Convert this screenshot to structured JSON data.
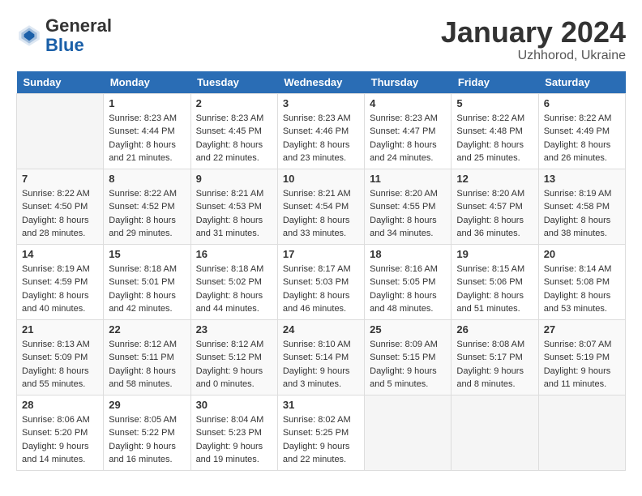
{
  "header": {
    "logo": {
      "general": "General",
      "blue": "Blue"
    },
    "title": "January 2024",
    "location": "Uzhhorod, Ukraine"
  },
  "calendar": {
    "days_of_week": [
      "Sunday",
      "Monday",
      "Tuesday",
      "Wednesday",
      "Thursday",
      "Friday",
      "Saturday"
    ],
    "weeks": [
      {
        "days": [
          {
            "num": "",
            "empty": true
          },
          {
            "num": "1",
            "sunrise": "Sunrise: 8:23 AM",
            "sunset": "Sunset: 4:44 PM",
            "daylight": "Daylight: 8 hours and 21 minutes."
          },
          {
            "num": "2",
            "sunrise": "Sunrise: 8:23 AM",
            "sunset": "Sunset: 4:45 PM",
            "daylight": "Daylight: 8 hours and 22 minutes."
          },
          {
            "num": "3",
            "sunrise": "Sunrise: 8:23 AM",
            "sunset": "Sunset: 4:46 PM",
            "daylight": "Daylight: 8 hours and 23 minutes."
          },
          {
            "num": "4",
            "sunrise": "Sunrise: 8:23 AM",
            "sunset": "Sunset: 4:47 PM",
            "daylight": "Daylight: 8 hours and 24 minutes."
          },
          {
            "num": "5",
            "sunrise": "Sunrise: 8:22 AM",
            "sunset": "Sunset: 4:48 PM",
            "daylight": "Daylight: 8 hours and 25 minutes."
          },
          {
            "num": "6",
            "sunrise": "Sunrise: 8:22 AM",
            "sunset": "Sunset: 4:49 PM",
            "daylight": "Daylight: 8 hours and 26 minutes."
          }
        ]
      },
      {
        "days": [
          {
            "num": "7",
            "sunrise": "Sunrise: 8:22 AM",
            "sunset": "Sunset: 4:50 PM",
            "daylight": "Daylight: 8 hours and 28 minutes."
          },
          {
            "num": "8",
            "sunrise": "Sunrise: 8:22 AM",
            "sunset": "Sunset: 4:52 PM",
            "daylight": "Daylight: 8 hours and 29 minutes."
          },
          {
            "num": "9",
            "sunrise": "Sunrise: 8:21 AM",
            "sunset": "Sunset: 4:53 PM",
            "daylight": "Daylight: 8 hours and 31 minutes."
          },
          {
            "num": "10",
            "sunrise": "Sunrise: 8:21 AM",
            "sunset": "Sunset: 4:54 PM",
            "daylight": "Daylight: 8 hours and 33 minutes."
          },
          {
            "num": "11",
            "sunrise": "Sunrise: 8:20 AM",
            "sunset": "Sunset: 4:55 PM",
            "daylight": "Daylight: 8 hours and 34 minutes."
          },
          {
            "num": "12",
            "sunrise": "Sunrise: 8:20 AM",
            "sunset": "Sunset: 4:57 PM",
            "daylight": "Daylight: 8 hours and 36 minutes."
          },
          {
            "num": "13",
            "sunrise": "Sunrise: 8:19 AM",
            "sunset": "Sunset: 4:58 PM",
            "daylight": "Daylight: 8 hours and 38 minutes."
          }
        ]
      },
      {
        "days": [
          {
            "num": "14",
            "sunrise": "Sunrise: 8:19 AM",
            "sunset": "Sunset: 4:59 PM",
            "daylight": "Daylight: 8 hours and 40 minutes."
          },
          {
            "num": "15",
            "sunrise": "Sunrise: 8:18 AM",
            "sunset": "Sunset: 5:01 PM",
            "daylight": "Daylight: 8 hours and 42 minutes."
          },
          {
            "num": "16",
            "sunrise": "Sunrise: 8:18 AM",
            "sunset": "Sunset: 5:02 PM",
            "daylight": "Daylight: 8 hours and 44 minutes."
          },
          {
            "num": "17",
            "sunrise": "Sunrise: 8:17 AM",
            "sunset": "Sunset: 5:03 PM",
            "daylight": "Daylight: 8 hours and 46 minutes."
          },
          {
            "num": "18",
            "sunrise": "Sunrise: 8:16 AM",
            "sunset": "Sunset: 5:05 PM",
            "daylight": "Daylight: 8 hours and 48 minutes."
          },
          {
            "num": "19",
            "sunrise": "Sunrise: 8:15 AM",
            "sunset": "Sunset: 5:06 PM",
            "daylight": "Daylight: 8 hours and 51 minutes."
          },
          {
            "num": "20",
            "sunrise": "Sunrise: 8:14 AM",
            "sunset": "Sunset: 5:08 PM",
            "daylight": "Daylight: 8 hours and 53 minutes."
          }
        ]
      },
      {
        "days": [
          {
            "num": "21",
            "sunrise": "Sunrise: 8:13 AM",
            "sunset": "Sunset: 5:09 PM",
            "daylight": "Daylight: 8 hours and 55 minutes."
          },
          {
            "num": "22",
            "sunrise": "Sunrise: 8:12 AM",
            "sunset": "Sunset: 5:11 PM",
            "daylight": "Daylight: 8 hours and 58 minutes."
          },
          {
            "num": "23",
            "sunrise": "Sunrise: 8:12 AM",
            "sunset": "Sunset: 5:12 PM",
            "daylight": "Daylight: 9 hours and 0 minutes."
          },
          {
            "num": "24",
            "sunrise": "Sunrise: 8:10 AM",
            "sunset": "Sunset: 5:14 PM",
            "daylight": "Daylight: 9 hours and 3 minutes."
          },
          {
            "num": "25",
            "sunrise": "Sunrise: 8:09 AM",
            "sunset": "Sunset: 5:15 PM",
            "daylight": "Daylight: 9 hours and 5 minutes."
          },
          {
            "num": "26",
            "sunrise": "Sunrise: 8:08 AM",
            "sunset": "Sunset: 5:17 PM",
            "daylight": "Daylight: 9 hours and 8 minutes."
          },
          {
            "num": "27",
            "sunrise": "Sunrise: 8:07 AM",
            "sunset": "Sunset: 5:19 PM",
            "daylight": "Daylight: 9 hours and 11 minutes."
          }
        ]
      },
      {
        "days": [
          {
            "num": "28",
            "sunrise": "Sunrise: 8:06 AM",
            "sunset": "Sunset: 5:20 PM",
            "daylight": "Daylight: 9 hours and 14 minutes."
          },
          {
            "num": "29",
            "sunrise": "Sunrise: 8:05 AM",
            "sunset": "Sunset: 5:22 PM",
            "daylight": "Daylight: 9 hours and 16 minutes."
          },
          {
            "num": "30",
            "sunrise": "Sunrise: 8:04 AM",
            "sunset": "Sunset: 5:23 PM",
            "daylight": "Daylight: 9 hours and 19 minutes."
          },
          {
            "num": "31",
            "sunrise": "Sunrise: 8:02 AM",
            "sunset": "Sunset: 5:25 PM",
            "daylight": "Daylight: 9 hours and 22 minutes."
          },
          {
            "num": "",
            "empty": true
          },
          {
            "num": "",
            "empty": true
          },
          {
            "num": "",
            "empty": true
          }
        ]
      }
    ]
  }
}
